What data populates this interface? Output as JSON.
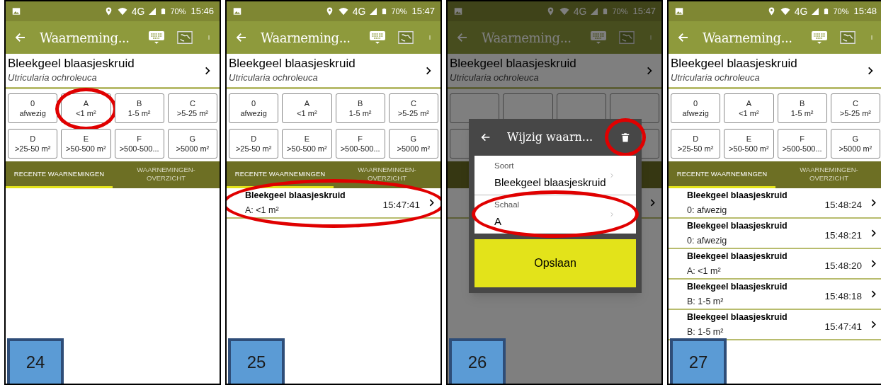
{
  "panels": [
    {
      "status": {
        "signal": "4G",
        "battery": "70%",
        "time": "15:46"
      },
      "toolbar": {
        "title": "Waarneming..."
      },
      "species": {
        "name": "Bleekgeel blaasjeskruid",
        "latin": "Utricularia ochroleuca"
      },
      "dimmed": false,
      "scales": [
        {
          "code": "0",
          "range": "afwezig",
          "circled": false
        },
        {
          "code": "A",
          "range": "<1 m²",
          "circled": true
        },
        {
          "code": "B",
          "range": "1-5 m²",
          "circled": false
        },
        {
          "code": "C",
          "range": ">5-25 m²",
          "circled": false
        },
        {
          "code": "D",
          "range": ">25-50 m²",
          "circled": false
        },
        {
          "code": "E",
          "range": ">50-500 m²",
          "circled": false
        },
        {
          "code": "F",
          "range": ">500-500...",
          "circled": false
        },
        {
          "code": "G",
          "range": ">5000 m²",
          "circled": false
        }
      ],
      "tabs": [
        {
          "label": "RECENTE WAARNEMINGEN",
          "selected": true
        },
        {
          "label": "WAARNEMINGEN-OVERZICHT",
          "selected": false
        }
      ],
      "step": "24"
    },
    {
      "status": {
        "signal": "4G",
        "battery": "70%",
        "time": "15:47"
      },
      "toolbar": {
        "title": "Waarneming..."
      },
      "species": {
        "name": "Bleekgeel blaasjeskruid",
        "latin": "Utricularia ochroleuca"
      },
      "dimmed": false,
      "scales": [
        {
          "code": "0",
          "range": "afwezig",
          "circled": false
        },
        {
          "code": "A",
          "range": "<1 m²",
          "circled": false
        },
        {
          "code": "B",
          "range": "1-5 m²",
          "circled": false
        },
        {
          "code": "C",
          "range": ">5-25 m²",
          "circled": false
        },
        {
          "code": "D",
          "range": ">25-50 m²",
          "circled": false
        },
        {
          "code": "E",
          "range": ">50-500 m²",
          "circled": false
        },
        {
          "code": "F",
          "range": ">500-500...",
          "circled": false
        },
        {
          "code": "G",
          "range": ">5000 m²",
          "circled": false
        }
      ],
      "tabs": [
        {
          "label": "RECENTE WAARNEMINGEN",
          "selected": true
        },
        {
          "label": "WAARNEMINGEN-OVERZICHT",
          "selected": false
        }
      ],
      "observations": [
        {
          "species": "Bleekgeel blaasjeskruid",
          "scale": "A: <1 m²",
          "time": "15:47:41",
          "circled": true
        }
      ],
      "step": "25"
    },
    {
      "status": {
        "signal": "4G",
        "battery": "70%",
        "time": "15:47"
      },
      "toolbar": {
        "title": "Waarneming..."
      },
      "species": {
        "name": "Bleekgeel blaasjeskruid",
        "latin": "Utricularia ochroleuca"
      },
      "dimmed": true,
      "dialog": {
        "title": "Wijzig waarn...",
        "trash_circled": true,
        "fields": [
          {
            "label": "Soort",
            "value": "Bleekgeel blaasjeskruid",
            "circled": false
          },
          {
            "label": "Schaal",
            "value": "A",
            "circled": true
          }
        ],
        "save": "Opslaan"
      },
      "step": "26"
    },
    {
      "status": {
        "signal": "4G",
        "battery": "70%",
        "time": "15:48"
      },
      "toolbar": {
        "title": "Waarneming..."
      },
      "species": {
        "name": "Bleekgeel blaasjeskruid",
        "latin": "Utricularia ochroleuca"
      },
      "dimmed": false,
      "scales": [
        {
          "code": "0",
          "range": "afwezig",
          "circled": false
        },
        {
          "code": "A",
          "range": "<1 m²",
          "circled": false
        },
        {
          "code": "B",
          "range": "1-5 m²",
          "circled": false
        },
        {
          "code": "C",
          "range": ">5-25 m²",
          "circled": false
        },
        {
          "code": "D",
          "range": ">25-50 m²",
          "circled": false
        },
        {
          "code": "E",
          "range": ">50-500 m²",
          "circled": false
        },
        {
          "code": "F",
          "range": ">500-500...",
          "circled": false
        },
        {
          "code": "G",
          "range": ">5000 m²",
          "circled": false
        }
      ],
      "tabs": [
        {
          "label": "RECENTE WAARNEMINGEN",
          "selected": true
        },
        {
          "label": "WAARNEMINGEN-OVERZICHT",
          "selected": false
        }
      ],
      "observations": [
        {
          "species": "Bleekgeel blaasjeskruid",
          "scale": "0: afwezig",
          "time": "15:48:24",
          "circled": false
        },
        {
          "species": "Bleekgeel blaasjeskruid",
          "scale": "0: afwezig",
          "time": "15:48:21",
          "circled": false
        },
        {
          "species": "Bleekgeel blaasjeskruid",
          "scale": "A: <1 m²",
          "time": "15:48:20",
          "circled": false
        },
        {
          "species": "Bleekgeel blaasjeskruid",
          "scale": "B: 1-5 m²",
          "time": "15:48:18",
          "circled": false
        },
        {
          "species": "Bleekgeel blaasjeskruid",
          "scale": "B: 1-5 m²",
          "time": "15:47:41",
          "circled": false
        }
      ],
      "step": "27"
    }
  ]
}
